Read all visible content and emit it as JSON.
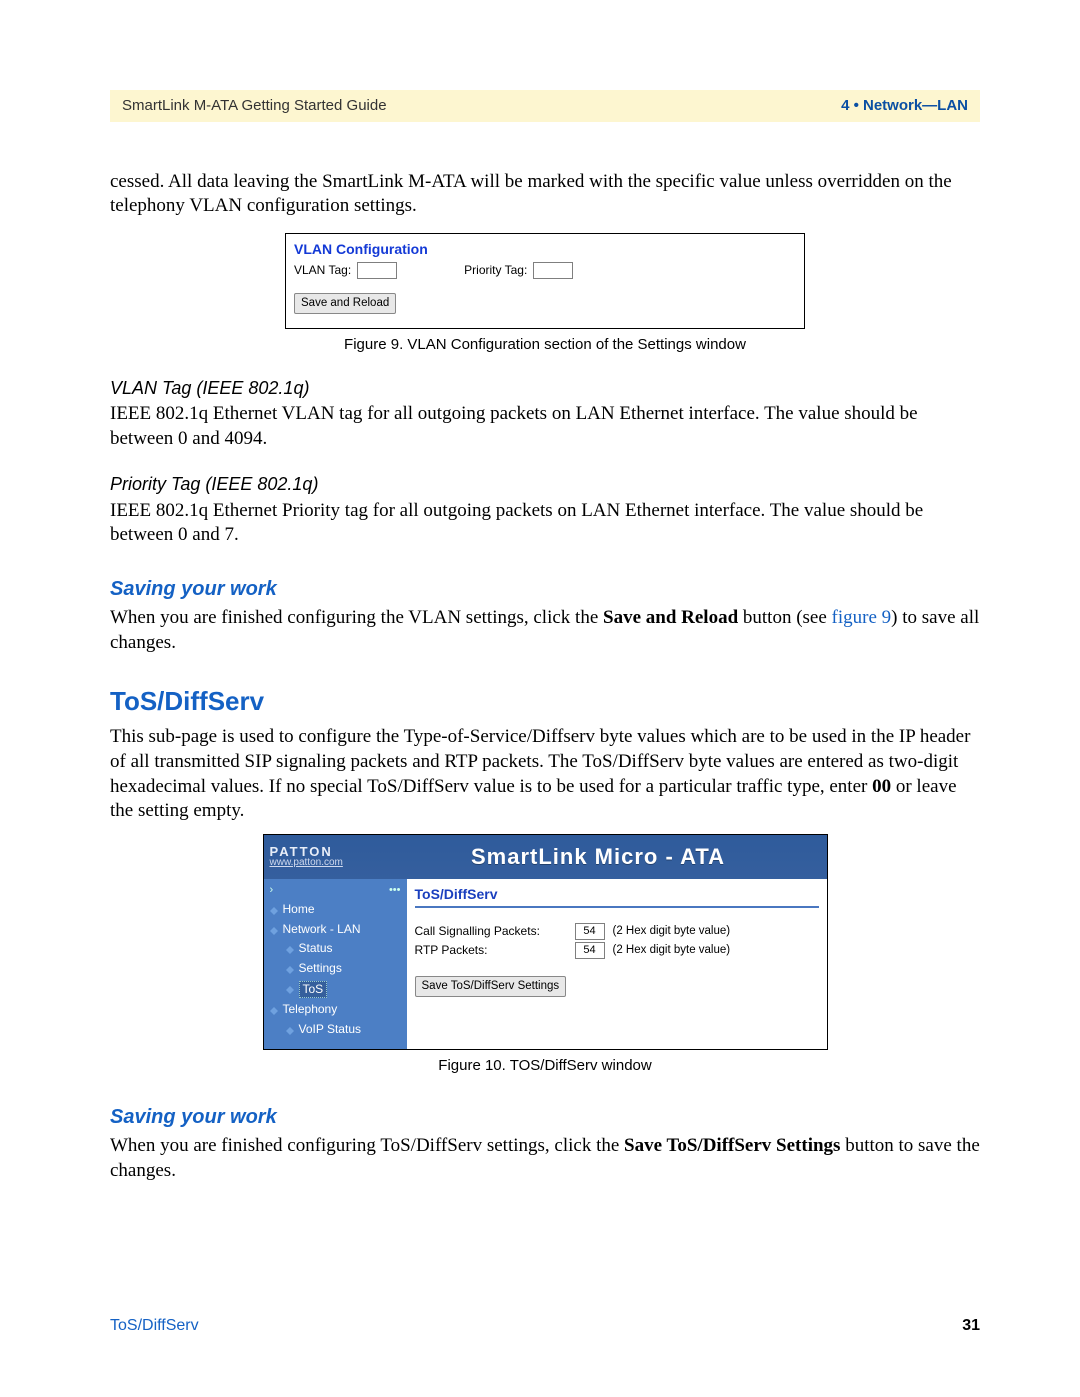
{
  "header": {
    "left": "SmartLink M-ATA Getting Started Guide",
    "right": "4 • Network—LAN"
  },
  "para_cessed": "cessed. All data leaving the SmartLink M-ATA will be marked with the specific value unless overridden on the telephony VLAN configuration settings.",
  "fig9": {
    "title": "VLAN Configuration",
    "vlan_label": "VLAN Tag:",
    "priority_label": "Priority Tag:",
    "button": "Save and Reload",
    "caption": "Figure 9. VLAN Configuration section of the Settings window"
  },
  "vlan_tag": {
    "heading": "VLAN Tag (IEEE 802.1q)",
    "body": "IEEE 802.1q Ethernet VLAN tag for all outgoing packets on LAN Ethernet interface. The value should be between 0 and 4094."
  },
  "priority_tag": {
    "heading": "Priority Tag (IEEE 802.1q)",
    "body": "IEEE 802.1q Ethernet Priority tag for all outgoing packets on LAN Ethernet interface. The value should be between 0 and 7."
  },
  "saving1": {
    "heading": "Saving your work",
    "body_before": "When you are finished configuring the VLAN settings, click the ",
    "bold": "Save and Reload",
    "body_mid": " button (see ",
    "link": "figure 9",
    "body_after": ") to save all changes."
  },
  "tosdiffserv": {
    "heading": "ToS/DiffServ",
    "body_before": "This sub-page is used to configure the Type-of-Service/Diffserv byte values which are to be used in the IP header of all transmitted SIP signaling packets and RTP packets. The ToS/DiffServ byte values are entered as two-digit hexadecimal values. If no special ToS/DiffServ value is to be used for a particular traffic type, enter ",
    "bold": "00",
    "body_after": " or leave the setting empty."
  },
  "fig10": {
    "brand": "PATTON",
    "url": "www.patton.com",
    "product": "SmartLink Micro - ATA",
    "nav_expand": "›",
    "nav_dots": "•••",
    "nav": {
      "home": "Home",
      "network": "Network - LAN",
      "status": "Status",
      "settings": "Settings",
      "tos": "ToS",
      "telephony": "Telephony",
      "voip": "VoIP Status"
    },
    "panel_title": "ToS/DiffServ",
    "row_csp_label": "Call Signalling Packets:",
    "row_csp_value": "54",
    "row_csp_hint": "(2 Hex digit byte value)",
    "row_rtp_label": "RTP Packets:",
    "row_rtp_value": "54",
    "row_rtp_hint": "(2 Hex digit byte value)",
    "button": "Save ToS/DiffServ Settings",
    "caption": "Figure 10. TOS/DiffServ window"
  },
  "saving2": {
    "heading": "Saving your work",
    "body_before": "When you are finished configuring ToS/DiffServ settings, click the ",
    "bold": "Save ToS/DiffServ Settings",
    "body_after": " button to save the changes."
  },
  "footer": {
    "left": "ToS/DiffServ",
    "right": "31"
  }
}
